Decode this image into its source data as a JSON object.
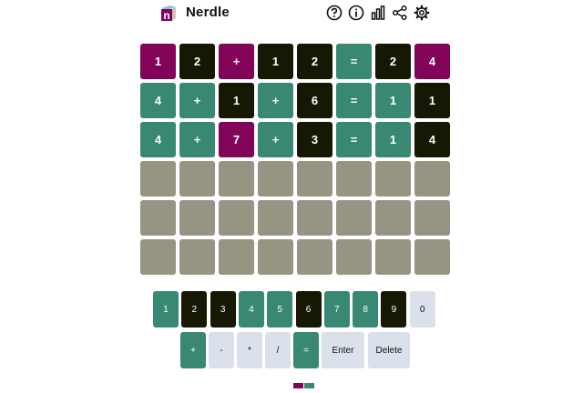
{
  "header": {
    "title": "Nerdle",
    "logo_letter": "n",
    "icons": [
      "help-icon",
      "info-icon",
      "stats-icon",
      "share-icon",
      "settings-icon"
    ]
  },
  "colors": {
    "correct": "#398874",
    "present": "#820458",
    "absent": "#161803",
    "empty": "#989484",
    "key_unused": "#dbe1eb",
    "key_unused_text": "#111111"
  },
  "board": {
    "rows": [
      [
        {
          "ch": "1",
          "s": "present"
        },
        {
          "ch": "2",
          "s": "absent"
        },
        {
          "ch": "+",
          "s": "present"
        },
        {
          "ch": "1",
          "s": "absent"
        },
        {
          "ch": "2",
          "s": "absent"
        },
        {
          "ch": "=",
          "s": "correct"
        },
        {
          "ch": "2",
          "s": "absent"
        },
        {
          "ch": "4",
          "s": "present"
        }
      ],
      [
        {
          "ch": "4",
          "s": "correct"
        },
        {
          "ch": "+",
          "s": "correct"
        },
        {
          "ch": "1",
          "s": "absent"
        },
        {
          "ch": "+",
          "s": "correct"
        },
        {
          "ch": "6",
          "s": "absent"
        },
        {
          "ch": "=",
          "s": "correct"
        },
        {
          "ch": "1",
          "s": "correct"
        },
        {
          "ch": "1",
          "s": "absent"
        }
      ],
      [
        {
          "ch": "4",
          "s": "correct"
        },
        {
          "ch": "+",
          "s": "correct"
        },
        {
          "ch": "7",
          "s": "present"
        },
        {
          "ch": "+",
          "s": "correct"
        },
        {
          "ch": "3",
          "s": "absent"
        },
        {
          "ch": "=",
          "s": "correct"
        },
        {
          "ch": "1",
          "s": "correct"
        },
        {
          "ch": "4",
          "s": "absent"
        }
      ],
      [
        {
          "ch": "",
          "s": "empty"
        },
        {
          "ch": "",
          "s": "empty"
        },
        {
          "ch": "",
          "s": "empty"
        },
        {
          "ch": "",
          "s": "empty"
        },
        {
          "ch": "",
          "s": "empty"
        },
        {
          "ch": "",
          "s": "empty"
        },
        {
          "ch": "",
          "s": "empty"
        },
        {
          "ch": "",
          "s": "empty"
        }
      ],
      [
        {
          "ch": "",
          "s": "empty"
        },
        {
          "ch": "",
          "s": "empty"
        },
        {
          "ch": "",
          "s": "empty"
        },
        {
          "ch": "",
          "s": "empty"
        },
        {
          "ch": "",
          "s": "empty"
        },
        {
          "ch": "",
          "s": "empty"
        },
        {
          "ch": "",
          "s": "empty"
        },
        {
          "ch": "",
          "s": "empty"
        }
      ],
      [
        {
          "ch": "",
          "s": "empty"
        },
        {
          "ch": "",
          "s": "empty"
        },
        {
          "ch": "",
          "s": "empty"
        },
        {
          "ch": "",
          "s": "empty"
        },
        {
          "ch": "",
          "s": "empty"
        },
        {
          "ch": "",
          "s": "empty"
        },
        {
          "ch": "",
          "s": "empty"
        },
        {
          "ch": "",
          "s": "empty"
        }
      ]
    ]
  },
  "keyboard": {
    "row1": [
      {
        "label": "1",
        "s": "correct"
      },
      {
        "label": "2",
        "s": "absent"
      },
      {
        "label": "3",
        "s": "absent"
      },
      {
        "label": "4",
        "s": "correct"
      },
      {
        "label": "5",
        "s": "correct"
      },
      {
        "label": "6",
        "s": "absent"
      },
      {
        "label": "7",
        "s": "correct"
      },
      {
        "label": "8",
        "s": "correct"
      },
      {
        "label": "9",
        "s": "absent"
      },
      {
        "label": "0",
        "s": "unused"
      }
    ],
    "row2": [
      {
        "label": "+",
        "s": "correct"
      },
      {
        "label": "-",
        "s": "unused"
      },
      {
        "label": "*",
        "s": "unused"
      },
      {
        "label": "/",
        "s": "unused"
      },
      {
        "label": "=",
        "s": "correct"
      },
      {
        "label": "Enter",
        "s": "unused"
      },
      {
        "label": "Delete",
        "s": "unused"
      }
    ]
  }
}
